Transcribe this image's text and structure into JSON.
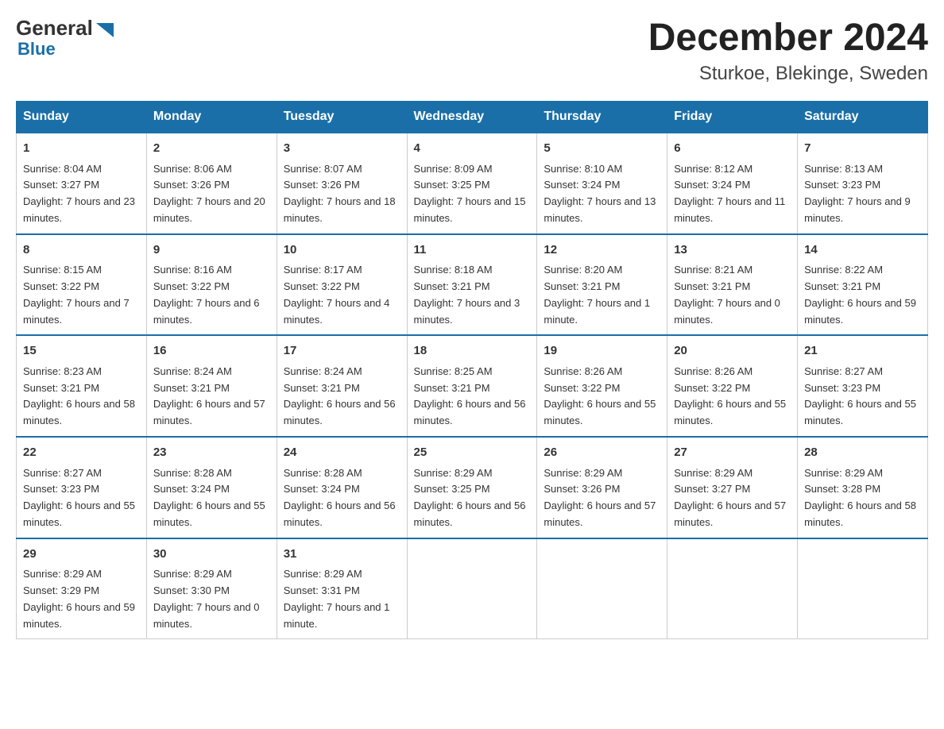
{
  "header": {
    "logo_general": "General",
    "logo_blue": "Blue",
    "title": "December 2024",
    "subtitle": "Sturkoe, Blekinge, Sweden"
  },
  "days_of_week": [
    "Sunday",
    "Monday",
    "Tuesday",
    "Wednesday",
    "Thursday",
    "Friday",
    "Saturday"
  ],
  "weeks": [
    [
      {
        "day": "1",
        "sunrise": "Sunrise: 8:04 AM",
        "sunset": "Sunset: 3:27 PM",
        "daylight": "Daylight: 7 hours and 23 minutes."
      },
      {
        "day": "2",
        "sunrise": "Sunrise: 8:06 AM",
        "sunset": "Sunset: 3:26 PM",
        "daylight": "Daylight: 7 hours and 20 minutes."
      },
      {
        "day": "3",
        "sunrise": "Sunrise: 8:07 AM",
        "sunset": "Sunset: 3:26 PM",
        "daylight": "Daylight: 7 hours and 18 minutes."
      },
      {
        "day": "4",
        "sunrise": "Sunrise: 8:09 AM",
        "sunset": "Sunset: 3:25 PM",
        "daylight": "Daylight: 7 hours and 15 minutes."
      },
      {
        "day": "5",
        "sunrise": "Sunrise: 8:10 AM",
        "sunset": "Sunset: 3:24 PM",
        "daylight": "Daylight: 7 hours and 13 minutes."
      },
      {
        "day": "6",
        "sunrise": "Sunrise: 8:12 AM",
        "sunset": "Sunset: 3:24 PM",
        "daylight": "Daylight: 7 hours and 11 minutes."
      },
      {
        "day": "7",
        "sunrise": "Sunrise: 8:13 AM",
        "sunset": "Sunset: 3:23 PM",
        "daylight": "Daylight: 7 hours and 9 minutes."
      }
    ],
    [
      {
        "day": "8",
        "sunrise": "Sunrise: 8:15 AM",
        "sunset": "Sunset: 3:22 PM",
        "daylight": "Daylight: 7 hours and 7 minutes."
      },
      {
        "day": "9",
        "sunrise": "Sunrise: 8:16 AM",
        "sunset": "Sunset: 3:22 PM",
        "daylight": "Daylight: 7 hours and 6 minutes."
      },
      {
        "day": "10",
        "sunrise": "Sunrise: 8:17 AM",
        "sunset": "Sunset: 3:22 PM",
        "daylight": "Daylight: 7 hours and 4 minutes."
      },
      {
        "day": "11",
        "sunrise": "Sunrise: 8:18 AM",
        "sunset": "Sunset: 3:21 PM",
        "daylight": "Daylight: 7 hours and 3 minutes."
      },
      {
        "day": "12",
        "sunrise": "Sunrise: 8:20 AM",
        "sunset": "Sunset: 3:21 PM",
        "daylight": "Daylight: 7 hours and 1 minute."
      },
      {
        "day": "13",
        "sunrise": "Sunrise: 8:21 AM",
        "sunset": "Sunset: 3:21 PM",
        "daylight": "Daylight: 7 hours and 0 minutes."
      },
      {
        "day": "14",
        "sunrise": "Sunrise: 8:22 AM",
        "sunset": "Sunset: 3:21 PM",
        "daylight": "Daylight: 6 hours and 59 minutes."
      }
    ],
    [
      {
        "day": "15",
        "sunrise": "Sunrise: 8:23 AM",
        "sunset": "Sunset: 3:21 PM",
        "daylight": "Daylight: 6 hours and 58 minutes."
      },
      {
        "day": "16",
        "sunrise": "Sunrise: 8:24 AM",
        "sunset": "Sunset: 3:21 PM",
        "daylight": "Daylight: 6 hours and 57 minutes."
      },
      {
        "day": "17",
        "sunrise": "Sunrise: 8:24 AM",
        "sunset": "Sunset: 3:21 PM",
        "daylight": "Daylight: 6 hours and 56 minutes."
      },
      {
        "day": "18",
        "sunrise": "Sunrise: 8:25 AM",
        "sunset": "Sunset: 3:21 PM",
        "daylight": "Daylight: 6 hours and 56 minutes."
      },
      {
        "day": "19",
        "sunrise": "Sunrise: 8:26 AM",
        "sunset": "Sunset: 3:22 PM",
        "daylight": "Daylight: 6 hours and 55 minutes."
      },
      {
        "day": "20",
        "sunrise": "Sunrise: 8:26 AM",
        "sunset": "Sunset: 3:22 PM",
        "daylight": "Daylight: 6 hours and 55 minutes."
      },
      {
        "day": "21",
        "sunrise": "Sunrise: 8:27 AM",
        "sunset": "Sunset: 3:23 PM",
        "daylight": "Daylight: 6 hours and 55 minutes."
      }
    ],
    [
      {
        "day": "22",
        "sunrise": "Sunrise: 8:27 AM",
        "sunset": "Sunset: 3:23 PM",
        "daylight": "Daylight: 6 hours and 55 minutes."
      },
      {
        "day": "23",
        "sunrise": "Sunrise: 8:28 AM",
        "sunset": "Sunset: 3:24 PM",
        "daylight": "Daylight: 6 hours and 55 minutes."
      },
      {
        "day": "24",
        "sunrise": "Sunrise: 8:28 AM",
        "sunset": "Sunset: 3:24 PM",
        "daylight": "Daylight: 6 hours and 56 minutes."
      },
      {
        "day": "25",
        "sunrise": "Sunrise: 8:29 AM",
        "sunset": "Sunset: 3:25 PM",
        "daylight": "Daylight: 6 hours and 56 minutes."
      },
      {
        "day": "26",
        "sunrise": "Sunrise: 8:29 AM",
        "sunset": "Sunset: 3:26 PM",
        "daylight": "Daylight: 6 hours and 57 minutes."
      },
      {
        "day": "27",
        "sunrise": "Sunrise: 8:29 AM",
        "sunset": "Sunset: 3:27 PM",
        "daylight": "Daylight: 6 hours and 57 minutes."
      },
      {
        "day": "28",
        "sunrise": "Sunrise: 8:29 AM",
        "sunset": "Sunset: 3:28 PM",
        "daylight": "Daylight: 6 hours and 58 minutes."
      }
    ],
    [
      {
        "day": "29",
        "sunrise": "Sunrise: 8:29 AM",
        "sunset": "Sunset: 3:29 PM",
        "daylight": "Daylight: 6 hours and 59 minutes."
      },
      {
        "day": "30",
        "sunrise": "Sunrise: 8:29 AM",
        "sunset": "Sunset: 3:30 PM",
        "daylight": "Daylight: 7 hours and 0 minutes."
      },
      {
        "day": "31",
        "sunrise": "Sunrise: 8:29 AM",
        "sunset": "Sunset: 3:31 PM",
        "daylight": "Daylight: 7 hours and 1 minute."
      },
      null,
      null,
      null,
      null
    ]
  ]
}
